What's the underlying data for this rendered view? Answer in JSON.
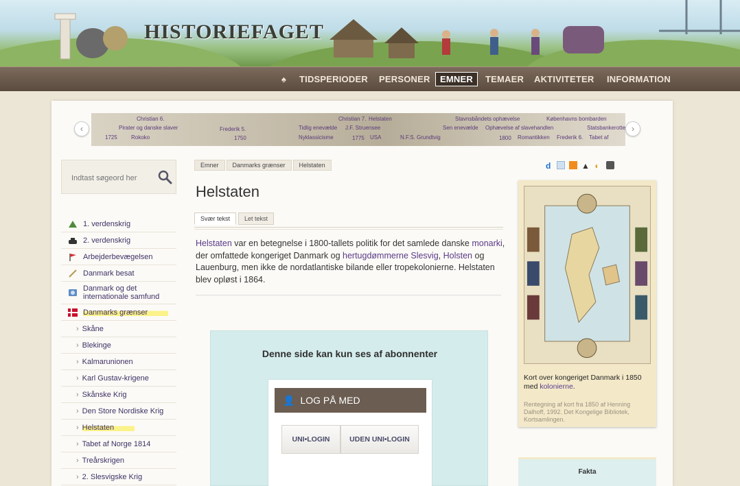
{
  "header": {
    "logo": "HISTORIEFAGET",
    "nav": [
      {
        "label": "TIDSPERIODER",
        "active": false
      },
      {
        "label": "PERSONER",
        "active": false
      },
      {
        "label": "EMNER",
        "active": true
      },
      {
        "label": "TEMAER",
        "active": false
      },
      {
        "label": "AKTIVITETER",
        "active": false
      },
      {
        "label": "INFORMATION",
        "active": false
      }
    ]
  },
  "timeline": {
    "labels": [
      "Christian 6.",
      "Pirater og danske slaver",
      "1725",
      "Rokoko",
      "Frederik 5.",
      "1750",
      "Christian 7.",
      "Tidlig enevælde",
      "Nyklassicisme",
      "Helstaten",
      "J.F. Struensee",
      "1775",
      "USA",
      "N.F.S. Grundtvig",
      "Stavnsbåndets ophævelse",
      "Sen enevælde",
      "Ophævelse af slavehandlen",
      "1800",
      "Romantikken",
      "Frederik 6.",
      "Tabet af",
      "Københavns bombarden",
      "Statsbankerotten"
    ]
  },
  "search": {
    "placeholder": "Indtast søgeord her"
  },
  "sidebar": {
    "items": [
      {
        "label": "1. verdenskrig",
        "icon": "tank-icon",
        "sub": false,
        "highlight": false
      },
      {
        "label": "2. verdenskrig",
        "icon": "tank-icon",
        "sub": false,
        "highlight": false
      },
      {
        "label": "Arbejderbevægelsen",
        "icon": "flag-icon",
        "sub": false,
        "highlight": false
      },
      {
        "label": "Danmark besat",
        "icon": "sword-icon",
        "sub": false,
        "highlight": false
      },
      {
        "label": "Danmark og det internationale samfund",
        "icon": "globe-icon",
        "sub": false,
        "highlight": false
      },
      {
        "label": "Danmarks grænser",
        "icon": "dannebrog-icon",
        "sub": false,
        "highlight": true
      },
      {
        "label": "Skåne",
        "sub": true,
        "highlight": false
      },
      {
        "label": "Blekinge",
        "sub": true,
        "highlight": false
      },
      {
        "label": "Kalmarunionen",
        "sub": true,
        "highlight": false
      },
      {
        "label": "Karl Gustav-krigene",
        "sub": true,
        "highlight": false
      },
      {
        "label": "Skånske Krig",
        "sub": true,
        "highlight": false
      },
      {
        "label": "Den Store Nordiske Krig",
        "sub": true,
        "highlight": false
      },
      {
        "label": "Helstaten",
        "sub": true,
        "highlight": true
      },
      {
        "label": "Tabet af Norge 1814",
        "sub": true,
        "highlight": false
      },
      {
        "label": "Treårskrigen",
        "sub": true,
        "highlight": false
      },
      {
        "label": "2. Slesvigske Krig",
        "sub": true,
        "highlight": false
      }
    ]
  },
  "breadcrumb": [
    "Emner",
    "Danmarks grænser",
    "Helstaten"
  ],
  "main": {
    "title": "Helstaten",
    "tabs": [
      "Svær tekst",
      "Let tekst"
    ],
    "text": {
      "l1": "Helstaten",
      "t1": " var en betegnelse i 1800-tallets politik for det samlede danske ",
      "l2": "monarki",
      "t2": ", der omfattede kongeriget Danmark og ",
      "l3": "hertugdømmerne Slesvig",
      "t3": ", ",
      "l4": "Holsten",
      "t4": " og Lauenburg, men ikke de nordatlantiske bilande eller tropekolonierne. Helstaten blev opløst i 1864."
    },
    "subscription": {
      "message": "Denne side kan kun ses af abonnenter",
      "login_header": "LOG PÅ MED",
      "btn_unilogin": "UNI•LOGIN",
      "btn_uden": "UDEN UNI•LOGIN"
    }
  },
  "right": {
    "icons": [
      "d-icon",
      "mail-icon",
      "rss-icon",
      "person-icon",
      "speaker-icon",
      "print-icon"
    ],
    "caption_pre": "Kort over kongeriget Danmark i 1850 med ",
    "caption_link": "kolonierne",
    "caption_post": ".",
    "credit": "Rentegning af kort fra 1850 af Henning Dalhoff, 1992. Det Kongelige Bibliotek, Kortsamlingen.",
    "fakta": "Fakta"
  },
  "colors": {
    "nav_bg": "#5a4b3e",
    "link": "#5a3a8a",
    "highlight": "#fbf28a",
    "sub_box": "#d5ecec"
  }
}
